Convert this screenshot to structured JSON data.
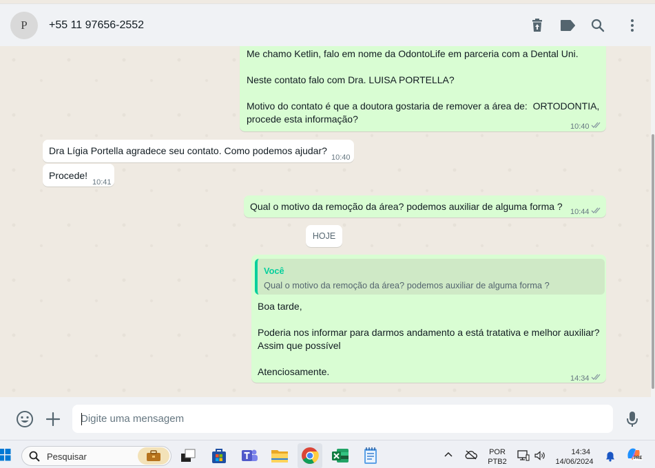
{
  "header": {
    "avatar_initial": "P",
    "contact": "+55 11 97656-2552",
    "icons": [
      "delete-icon",
      "label-icon",
      "search-icon",
      "menu-icon"
    ]
  },
  "messages": {
    "m1": {
      "line1": "Me chamo Ketlin, falo em nome da OdontoLife em parceria com a Dental Uni.",
      "line2": "Neste contato falo com Dra. LUISA PORTELLA?",
      "line3": "Motivo do contato é que a doutora gostaria de remover a área de:  ORTODONTIA,",
      "line4": "procede esta informação?",
      "time": "10:40"
    },
    "m2": {
      "text": "Dra Lígia Portella agradece seu contato. Como podemos ajudar?",
      "time": "10:40"
    },
    "m3": {
      "text": "Procede!",
      "time": "10:41"
    },
    "m4": {
      "text": "Qual o motivo da remoção da área? podemos auxiliar de alguma forma ?",
      "time": "10:44"
    },
    "date_chip": "HOJE",
    "m5": {
      "quote_author": "Você",
      "quote_text": "Qual o motivo da remoção da área? podemos auxiliar de alguma forma ?",
      "line1": "Boa tarde,",
      "line2": "Poderia nos informar para darmos andamento a está tratativa e melhor auxiliar?",
      "line3": "Assim que possível",
      "line4": "Atenciosamente.",
      "time": "14:34"
    }
  },
  "composer": {
    "placeholder": "Digite uma mensagem",
    "icons": [
      "emoji-icon",
      "attach-plus-icon",
      "microphone-icon"
    ]
  },
  "taskbar": {
    "search_label": "Pesquisar",
    "lang_top": "POR",
    "lang_bottom": "PTB2",
    "clock_time": "14:34",
    "clock_date": "14/06/2024",
    "copilot_badge": "PRE",
    "colors": {
      "accent": "#06cf9c",
      "out_bubble": "#d9fdd3",
      "chat_bg": "#efeae2"
    }
  }
}
